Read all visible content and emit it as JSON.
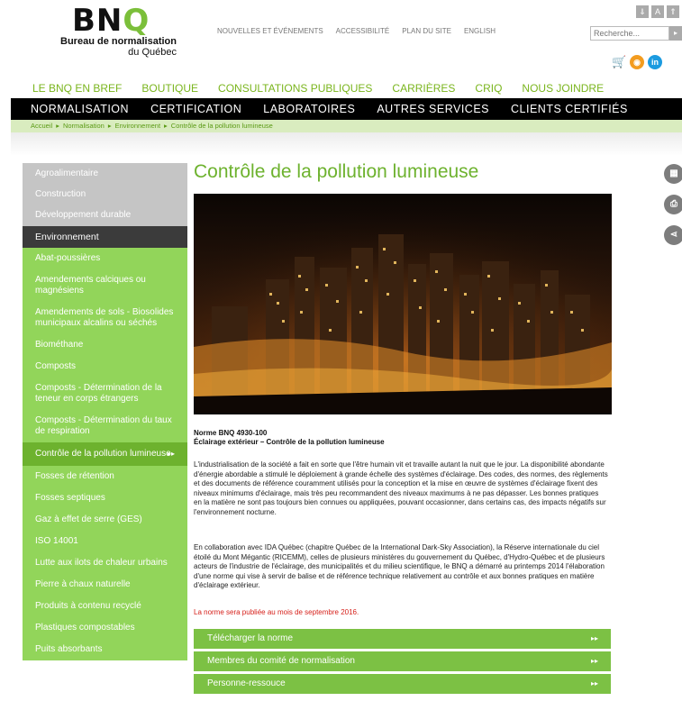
{
  "logo": {
    "mark_b": "BN",
    "mark_q": "Q",
    "line1": "Bureau de normalisation",
    "line2": "du Québec"
  },
  "top_links": [
    "NOUVELLES ET ÉVÉNEMENTS",
    "ACCESSIBILITÉ",
    "PLAN DU SITE",
    "ENGLISH"
  ],
  "accessibility_buttons": [
    "⇓",
    "A",
    "⇑"
  ],
  "search": {
    "placeholder": "Recherche...",
    "button": "▸"
  },
  "nav_primary": [
    "LE BNQ EN BREF",
    "BOUTIQUE",
    "CONSULTATIONS PUBLIQUES",
    "CARRIÈRES",
    "CRIQ",
    "NOUS JOINDRE"
  ],
  "nav_secondary": [
    "NORMALISATION",
    "CERTIFICATION",
    "LABORATOIRES",
    "AUTRES SERVICES",
    "CLIENTS CERTIFIÉS"
  ],
  "breadcrumb": [
    "Accueil",
    "Normalisation",
    "Environnement",
    "Contrôle de la pollution lumineuse"
  ],
  "sidebar": {
    "top_items": [
      "Agroalimentaire",
      "Construction",
      "Développement durable"
    ],
    "section": "Environnement",
    "items": [
      "Abat-poussières",
      "Amendements calciques ou magnésiens",
      "Amendements de sols - Biosolides municipaux alcalins ou séchés",
      "Biométhane",
      "Composts",
      "Composts - Détermination de la teneur en corps étrangers",
      "Composts - Détermination du taux de respiration",
      "Contrôle de la pollution lumineuse",
      "Fosses de rétention",
      "Fosses septiques",
      "Gaz à effet de serre (GES)",
      "ISO 14001",
      "Lutte aux ilots de chaleur urbains",
      "Pierre à chaux naturelle",
      "Produits à contenu recyclé",
      "Plastiques compostables",
      "Puits absorbants"
    ],
    "selected_index": 7
  },
  "page": {
    "title": "Contrôle de la pollution lumineuse",
    "std_number": "Norme BNQ 4930-100",
    "std_title": "Éclairage extérieur – Contrôle de la pollution lumineuse",
    "paragraph1": "L'industrialisation de la société a fait en sorte que l'être humain vit et travaille autant la nuit que le jour. La disponibilité abondante d'énergie abordable a stimulé le déploiement à grande échelle des systèmes d'éclairage. Des codes, des normes, des règlements et des documents de référence couramment utilisés pour la conception et la mise en œuvre de systèmes d'éclairage fixent des niveaux minimums d'éclairage, mais très peu recommandent des niveaux maximums à ne pas dépasser. Les bonnes pratiques en la matière ne sont pas toujours bien connues ou appliquées, pouvant occasionner, dans certains cas, des impacts négatifs sur l'environnement nocturne.",
    "paragraph2": "En collaboration avec IDA Québec (chapitre Québec de la International Dark-Sky Association), la Réserve internationale du ciel étoilé du Mont Mégantic (RICEMM), celles de plusieurs ministères du gouvernement du Québec, d'Hydro-Québec et de plusieurs acteurs de l'industrie de l'éclairage, des municipalités et du milieu scientifique, le BNQ a démarré au printemps 2014 l'élaboration d'une norme qui vise à servir de balise et de référence technique relativement au contrôle et aux bonnes pratiques en matière d'éclairage extérieur.",
    "publication_note": "La norme sera publiée au mois de septembre 2016.",
    "buttons": [
      "Télécharger la norme",
      "Membres du comité de normalisation",
      "Personne-ressouce"
    ]
  },
  "colors": {
    "brand_green": "#7ab51d",
    "button_green": "#7cc144",
    "sidebar_green": "#92d55a",
    "alert_red": "#d6211b"
  }
}
